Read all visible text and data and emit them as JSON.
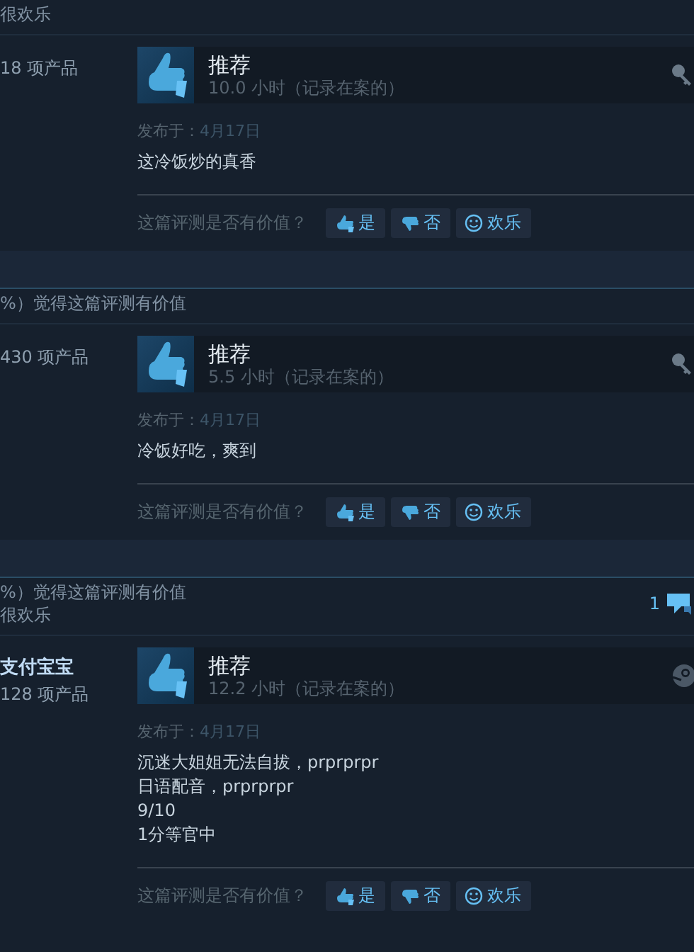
{
  "reviews": [
    {
      "header_lines": [
        "很欢乐"
      ],
      "author": {
        "products": "18 项产品"
      },
      "verdict": "推荐",
      "hours": "10.0 小时（记录在案的）",
      "purchase_icon": {
        "kind": "key"
      },
      "date_label": "发布于：",
      "date": "4月17日",
      "content": [
        "这冷饭炒的真香"
      ],
      "question": "这篇评测是否有价值？",
      "buttons": [
        {
          "kind": "yes",
          "label": "是"
        },
        {
          "kind": "no",
          "label": "否"
        },
        {
          "kind": "funny",
          "label": "欢乐"
        }
      ]
    },
    {
      "header_lines": [
        "%）觉得这篇评测有价值"
      ],
      "author": {
        "products": "430 项产品"
      },
      "verdict": "推荐",
      "hours": "5.5 小时（记录在案的）",
      "purchase_icon": {
        "kind": "key"
      },
      "date_label": "发布于：",
      "date": "4月17日",
      "content": [
        "冷饭好吃，爽到"
      ],
      "question": "这篇评测是否有价值？",
      "buttons": [
        {
          "kind": "yes",
          "label": "是"
        },
        {
          "kind": "no",
          "label": "否"
        },
        {
          "kind": "funny",
          "label": "欢乐"
        }
      ]
    },
    {
      "header_lines": [
        "%）觉得这篇评测有价值",
        "很欢乐"
      ],
      "comments": "1",
      "author": {
        "name": "支付宝宝",
        "products": "128 项产品"
      },
      "verdict": "推荐",
      "hours": "12.2 小时（记录在案的）",
      "purchase_icon": {
        "kind": "steam"
      },
      "date_label": "发布于：",
      "date": "4月17日",
      "content": [
        "沉迷大姐姐无法自拔，prprprpr",
        "日语配音，prprprpr",
        "9/10",
        "1分等官中"
      ],
      "question": "这篇评测是否有价值？",
      "buttons": [
        {
          "kind": "yes",
          "label": "是"
        },
        {
          "kind": "no",
          "label": "否"
        },
        {
          "kind": "funny",
          "label": "欢乐"
        }
      ]
    }
  ]
}
